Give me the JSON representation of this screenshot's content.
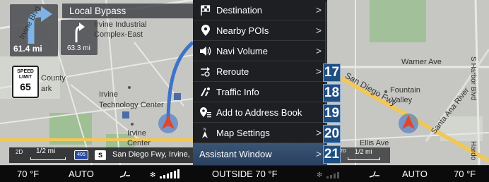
{
  "nav": {
    "road_name": "Local Bypass",
    "next_turn_distance": "61.4 mi",
    "second_turn_distance": "63.3 mi",
    "speed_limit_caption": "SPEED LIMIT",
    "speed_limit_value": "65"
  },
  "map_left_labels": {
    "irvine_industrial": "Irvine Industrial",
    "complex_east": "Complex-East",
    "irvine": "Irvine",
    "technology_center": "Technology Center",
    "irvine_center_1": "Irvine",
    "irvine_center_2": "Center",
    "county": "County",
    "park": "ark",
    "irvine_blvd": "Irvine Blvd"
  },
  "map_right_labels": {
    "warner_ave": "Warner Ave",
    "san_diego_fwy": "San Diego Fwy",
    "fountain": "Fountain",
    "valley": "Valley",
    "santa_ana_river": "Santa Ana River",
    "harbor_blvd": "S Harbor Blvd",
    "ellis_ave": "Ellis Ave",
    "hardo": "Hardo"
  },
  "bottom_bar_left": {
    "view_mode": "2D",
    "scale": "1/2 mi",
    "shield_interstate": "405",
    "shield_s": "S",
    "street": "San Diego Fwy, Irvine,"
  },
  "bottom_bar_right": {
    "view_mode": "2D",
    "scale": "1/2 mi"
  },
  "menu": {
    "items": [
      {
        "label": "Destination",
        "icon": "flag-icon",
        "has_arrow": true
      },
      {
        "label": "Nearby POIs",
        "icon": "location-pin-icon",
        "has_arrow": true
      },
      {
        "label": "Navi Volume",
        "icon": "speaker-icon",
        "has_arrow": true
      },
      {
        "label": "Reroute",
        "icon": "reroute-icon",
        "has_arrow": true
      },
      {
        "label": "Traffic Info",
        "icon": "traffic-icon",
        "has_arrow": false
      },
      {
        "label": "Add to Address Book",
        "icon": "add-address-icon",
        "has_arrow": false
      },
      {
        "label": "Map Settings",
        "icon": "compass-icon",
        "has_arrow": true
      },
      {
        "label": "Assistant Window",
        "icon": "",
        "has_arrow": true
      }
    ],
    "selected_index": 7,
    "arrow_glyph": ">"
  },
  "callouts": [
    "17",
    "18",
    "19",
    "20",
    "21"
  ],
  "status_bar": {
    "left_temp": "70 °F",
    "left_mode": "AUTO",
    "outside": "OUTSIDE  70 °F",
    "right_mode": "AUTO",
    "right_temp": "70 °F"
  },
  "colors": {
    "menu_bg": "#1d1f22",
    "selected_bg": "#3a5575",
    "callout_bg": "#1f4e82",
    "route": "#3f73c8",
    "freeway": "#f0c75a",
    "vehicle": "#e2452a"
  }
}
